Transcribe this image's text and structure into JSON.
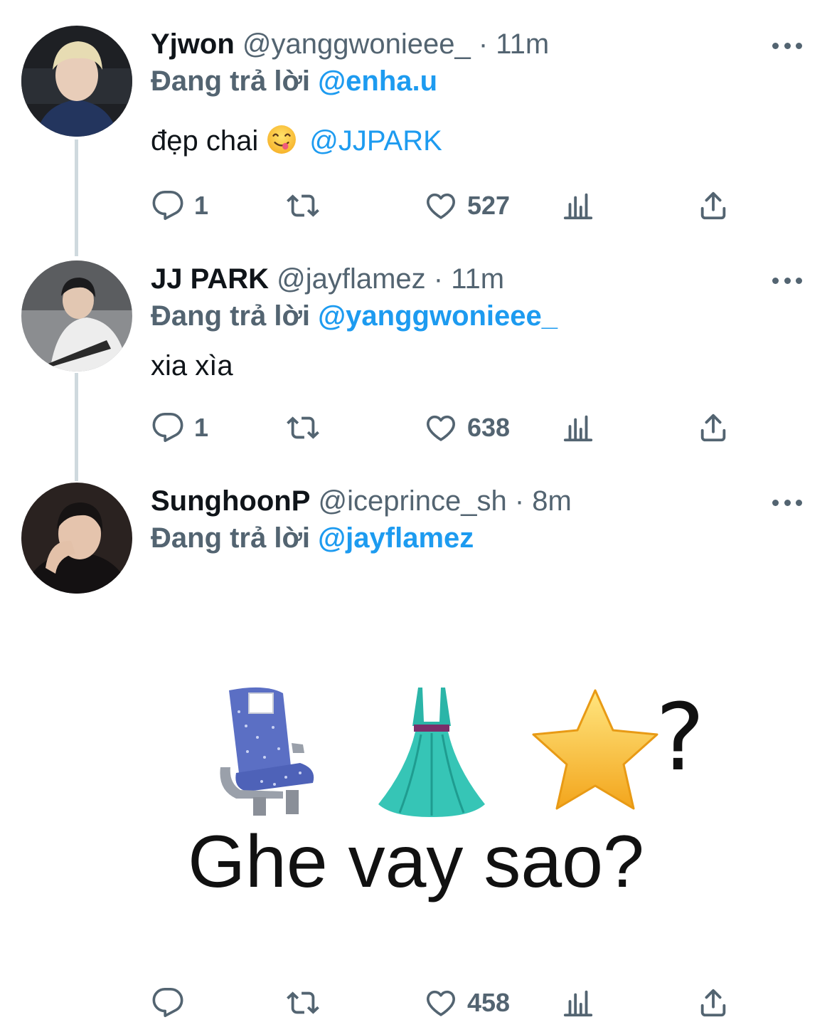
{
  "tweets": [
    {
      "display_name": "Yjwon",
      "handle": "@yanggwonieee_",
      "time": "· 11m",
      "reply_prefix": "Đang trả lời",
      "reply_to": "@enha.u",
      "text": "đẹp chai",
      "text_emoji": "savoring-food-face-emoji",
      "text_mention": "@JJPARK",
      "replies": "1",
      "retweets": "",
      "likes": "527"
    },
    {
      "display_name": "JJ PARK",
      "handle": "@jayflamez",
      "time": "· 11m",
      "reply_prefix": "Đang trả lời",
      "reply_to": "@yanggwonieee_",
      "text": "xia xìa",
      "replies": "1",
      "retweets": "",
      "likes": "638"
    },
    {
      "display_name": "SunghoonP",
      "handle": "@iceprince_sh",
      "time": "· 8m",
      "reply_prefix": "Đang trả lời",
      "reply_to": "@jayflamez",
      "media": {
        "emojis": [
          "seat-emoji",
          "dress-emoji",
          "star-emoji"
        ],
        "question_mark": "?",
        "caption": "Ghe vay sao?"
      },
      "replies": "",
      "retweets": "",
      "likes": "458"
    }
  ],
  "icons": {
    "reply": "reply-bubble-icon",
    "retweet": "retweet-icon",
    "like": "heart-icon",
    "views": "views-bar-chart-icon",
    "share": "share-upload-icon",
    "more": "more-dots-icon"
  },
  "colors": {
    "mention": "#1d9bf0",
    "secondary_text": "#536471",
    "primary_text": "#0f1419",
    "thread_line": "#cfd9de"
  }
}
